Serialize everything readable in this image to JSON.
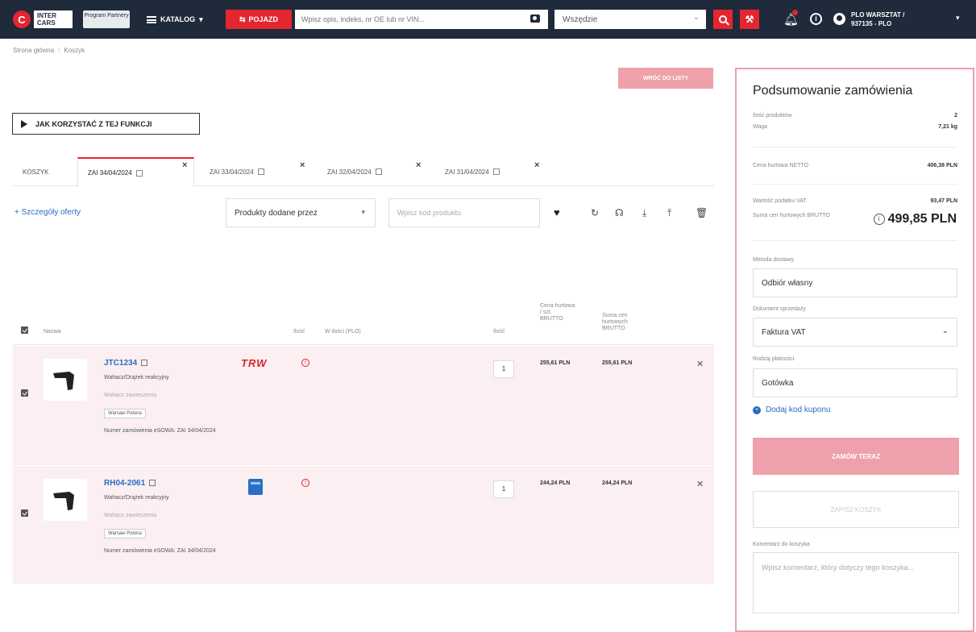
{
  "header": {
    "logo_mark": "C",
    "logo_text": "INTER CARS",
    "program_button": "Program Partnery",
    "katalog_label": "KATALOG",
    "pojazd_label": "POJAZD",
    "search_placeholder": "Wpisz opis, indeks, nr OE lub nr VIN...",
    "scope_value": "Wszędzie",
    "user_line1": "PLO WARSZTAT /",
    "user_line2": "937135 - PLO",
    "accent_color": "#e3262f",
    "bar_color": "#1f2a3a"
  },
  "breadcrumb": {
    "home": "Strona główna",
    "current": "Koszyk"
  },
  "top_actions": {
    "order_button": "WRÓĆ DO LISTY"
  },
  "howto": {
    "label": "JAK KORZYSTAĆ Z TEJ FUNKCJI"
  },
  "tabs": [
    {
      "label": "KOSZYK"
    },
    {
      "label": "ZAI 34/04/2024"
    },
    {
      "label": "ZAI 33/04/2024"
    },
    {
      "label": "ZAI 32/04/2024"
    },
    {
      "label": "ZAI 31/04/2024"
    }
  ],
  "toolbar": {
    "offer_details_link": "+ Szczegóły oferty",
    "added_by_select": "Produkty dodane przez",
    "code_placeholder": "Wpisz kod produktu"
  },
  "table": {
    "col_name": "Nazwa",
    "col_qty_available": "Ilość",
    "col_in_stock": "W ilości (PLO)",
    "col_qty": "Ilość",
    "col_price": "Cena hurtowa / szt. BRUTTO",
    "col_sum": "Suma cen hurtowych BRUTTO",
    "rows": [
      {
        "code": "JTC1234",
        "desc": "Wahacz/Drążek reakcyjny",
        "desc2": "Wahacz zawieszenia",
        "tag": "Warsaw Polona",
        "order_no": "Numer zamówienia eSOWA: ZAI 34/04/2024",
        "brand": "TRW",
        "qty": "1",
        "price": "255,61 PLN",
        "sum": "255,61 PLN"
      },
      {
        "code": "RH04-2061",
        "desc": "Wahacz/Drążek reakcyjny",
        "desc2": "Wahacz zawieszenia",
        "tag": "Warsaw Polona",
        "order_no": "Numer zamówienia eSOWA: ZAI 34/04/2024",
        "brand": "",
        "qty": "1",
        "price": "244,24 PLN",
        "sum": "244,24 PLN"
      }
    ]
  },
  "summary": {
    "title": "Podsumowanie zamówienia",
    "products_label": "Ilość produktów",
    "products_value": "2",
    "weight_label": "Waga",
    "weight_value": "7,21 kg",
    "netto_label": "Cena hurtowa NETTO",
    "netto_value": "406,38 PLN",
    "vat_label": "Wartość podatku VAT",
    "vat_value": "93,47 PLN",
    "brutto_label": "Suma cen hurtowych BRUTTO",
    "brutto_value": "499,85 PLN",
    "delivery_label": "Metoda dostawy",
    "delivery_value": "Odbiór własny",
    "document_label": "Dokument sprzedaży",
    "document_value": "Faktura VAT",
    "payment_label": "Rodzaj płatności",
    "payment_value": "Gotówka",
    "coupon_link": "Dodaj kod kuponu",
    "order_button": "ZAMÓW TERAZ",
    "save_button": "ZAPISZ KOSZYK",
    "comment_label": "Komentarz do koszyka",
    "comment_placeholder": "Wpisz komentarz, który dotyczy tego koszyka..."
  }
}
